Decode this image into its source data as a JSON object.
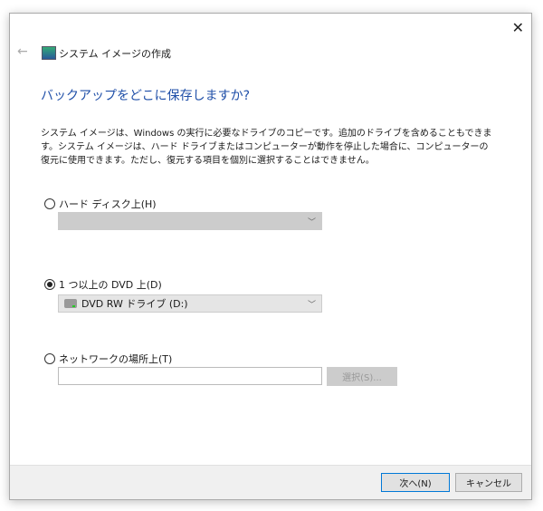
{
  "window": {
    "title": "システム イメージの作成",
    "close": "✕",
    "back": "←"
  },
  "heading": "バックアップをどこに保存しますか?",
  "description": "システム イメージは、Windows の実行に必要なドライブのコピーです。追加のドライブを含めることもできます。システム イメージは、ハード ドライブまたはコンピューターが動作を停止した場合に、コンピューターの復元に使用できます。ただし、復元する項目を個別に選択することはできません。",
  "options": {
    "hard_disk": {
      "label": "ハード ディスク上(H)",
      "selected": false,
      "value": ""
    },
    "dvd": {
      "label": "1 つ以上の DVD 上(D)",
      "selected": true,
      "value": "DVD RW ドライブ (D:)"
    },
    "network": {
      "label": "ネットワークの場所上(T)",
      "selected": false,
      "value": "",
      "browse": "選択(S)..."
    }
  },
  "footer": {
    "next": "次へ(N)",
    "cancel": "キャンセル"
  }
}
